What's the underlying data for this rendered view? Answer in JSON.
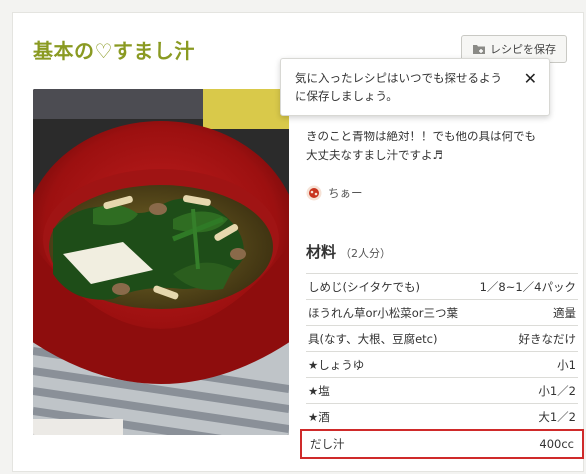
{
  "recipe": {
    "title": "基本の♡すまし汁",
    "save_label": "レシピを保存",
    "tooltip": {
      "text": "気に入ったレシピはいつでも探せるように保存しましょう。",
      "close": "✕"
    },
    "description": {
      "line1": "きのこと青物は絶対！！でも他の具は何でも",
      "line2": "大丈夫なすまし汁ですよ♬"
    },
    "author": "ちぁー",
    "ingredients_heading": "材料",
    "servings": "（2人分）",
    "ingredients": [
      {
        "name": "しめじ(シイタケでも)",
        "amount": "1／8~1／4パック"
      },
      {
        "name": "ほうれん草or小松菜or三つ葉",
        "amount": "適量"
      },
      {
        "name": "具(なす、大根、豆腐etc)",
        "amount": "好きなだけ"
      },
      {
        "name": "★しょうゆ",
        "amount": "小1"
      },
      {
        "name": "★塩",
        "amount": "小1／2"
      },
      {
        "name": "★酒",
        "amount": "大1／2"
      },
      {
        "name": "だし汁",
        "amount": "400cc"
      }
    ]
  },
  "colors": {
    "title": "#8a9a22",
    "highlight_border": "#cf2a2a"
  },
  "icons": {
    "save": "folder-icon",
    "close": "close-icon",
    "author": "avatar-icon"
  }
}
